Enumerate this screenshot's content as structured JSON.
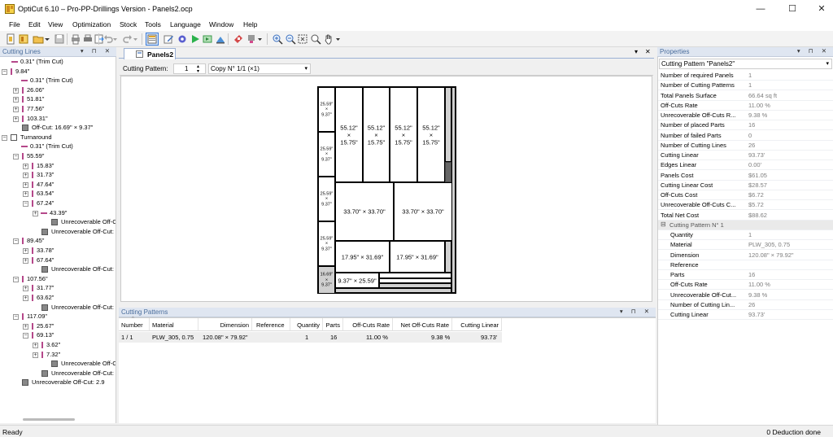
{
  "window": {
    "title": "OptiCut 6.10 – Pro-PP-Drillings Version - Panels2.ocp",
    "minimize": "—",
    "maximize": "☐",
    "close": "✕"
  },
  "menu": [
    "File",
    "Edit",
    "View",
    "Optimization",
    "Stock",
    "Tools",
    "Language",
    "Window",
    "Help"
  ],
  "toolbar_icons": [
    "new-icon",
    "new-project-icon",
    "open-icon",
    "dropdown-arrow",
    "save-icon",
    "print-preview-icon",
    "print-icon",
    "export-icon",
    "undo-icon",
    "undo-dropdown",
    "redo-icon",
    "redo-dropdown",
    "properties-icon",
    "edit-icon",
    "optimize-settings-icon",
    "run-icon",
    "step-icon",
    "report-icon",
    "label-icon",
    "drill-icon",
    "zoom-in-icon",
    "zoom-out-icon",
    "zoom-fit-icon",
    "zoom-window-icon",
    "pan-hand-icon",
    "overflow-icon"
  ],
  "cutting_lines": {
    "title": "Cutting Lines",
    "items": [
      {
        "label": "0.31\" (Trim Cut)",
        "type": "line",
        "level": 1
      },
      {
        "label": "9.84\"",
        "type": "bar",
        "level": 0,
        "expander": "-"
      },
      {
        "label": "0.31\" (Trim Cut)",
        "type": "line",
        "level": 2
      },
      {
        "label": "26.06\"",
        "type": "bar",
        "level": 2,
        "expander": "+"
      },
      {
        "label": "51.81\"",
        "type": "bar",
        "level": 2,
        "expander": "+"
      },
      {
        "label": "77.56\"",
        "type": "bar",
        "level": 2,
        "expander": "+"
      },
      {
        "label": "103.31\"",
        "type": "bar",
        "level": 2,
        "expander": "+"
      },
      {
        "label": "Off-Cut: 16.69\" × 9.37\"",
        "type": "box",
        "level": 2
      },
      {
        "label": "Turnaround",
        "type": "whitebox",
        "level": 0,
        "expander": "-"
      },
      {
        "label": "0.31\" (Trim Cut)",
        "type": "line",
        "level": 2
      },
      {
        "label": "55.59\"",
        "type": "bar",
        "level": 2,
        "expander": "-"
      },
      {
        "label": "15.83\"",
        "type": "bar",
        "level": 3,
        "expander": "+"
      },
      {
        "label": "31.73\"",
        "type": "bar",
        "level": 3,
        "expander": "+"
      },
      {
        "label": "47.64\"",
        "type": "bar",
        "level": 3,
        "expander": "+"
      },
      {
        "label": "63.54\"",
        "type": "bar",
        "level": 3,
        "expander": "+"
      },
      {
        "label": "67.24\"",
        "type": "bar",
        "level": 3,
        "expander": "-"
      },
      {
        "label": "43.39\"",
        "type": "line",
        "level": 4,
        "expander": "+"
      },
      {
        "label": "Unrecoverable Off-C",
        "type": "box",
        "level": 5
      },
      {
        "label": "Unrecoverable Off-Cut:",
        "type": "box",
        "level": 4
      },
      {
        "label": "89.45\"",
        "type": "bar",
        "level": 2,
        "expander": "-"
      },
      {
        "label": "33.78\"",
        "type": "bar",
        "level": 3,
        "expander": "+"
      },
      {
        "label": "67.64\"",
        "type": "bar",
        "level": 3,
        "expander": "+"
      },
      {
        "label": "Unrecoverable Off-Cut:",
        "type": "box",
        "level": 4
      },
      {
        "label": "107.56\"",
        "type": "bar",
        "level": 2,
        "expander": "-"
      },
      {
        "label": "31.77\"",
        "type": "bar",
        "level": 3,
        "expander": "+"
      },
      {
        "label": "63.62\"",
        "type": "bar",
        "level": 3,
        "expander": "+"
      },
      {
        "label": "Unrecoverable Off-Cut:",
        "type": "box",
        "level": 4
      },
      {
        "label": "117.09\"",
        "type": "bar",
        "level": 2,
        "expander": "-"
      },
      {
        "label": "25.67\"",
        "type": "bar",
        "level": 3,
        "expander": "+"
      },
      {
        "label": "69.13\"",
        "type": "bar",
        "level": 3,
        "expander": "-"
      },
      {
        "label": "3.62\"",
        "type": "bar",
        "level": 4,
        "expander": "+"
      },
      {
        "label": "7.32\"",
        "type": "bar",
        "level": 4,
        "expander": "+"
      },
      {
        "label": "Unrecoverable Off-C",
        "type": "box",
        "level": 5
      },
      {
        "label": "Unrecoverable Off-Cut:",
        "type": "box",
        "level": 4
      },
      {
        "label": "Unrecoverable Off-Cut: 2.9",
        "type": "box",
        "level": 2
      }
    ]
  },
  "document": {
    "tab": "Panels2",
    "pattern_label": "Cutting Pattern:",
    "pattern_value": "1",
    "copy_value": "Copy N° 1/1 (×1)"
  },
  "layout_pieces": {
    "strip_label_a": "25.59\"",
    "strip_label_b": "×",
    "strip_label_c": "9.37\"",
    "offcut_a": "16.69\"",
    "offcut_c": "9.37\"",
    "p55_a": "55.12\"",
    "p55_b": "×",
    "p55_c": "15.75\"",
    "p33": "33.70\" × 33.70\"",
    "p17": "17.95\" × 31.69\"",
    "p9": "9.37\" × 25.59\""
  },
  "cutting_patterns": {
    "title": "Cutting Patterns",
    "columns": [
      "Number",
      "Material",
      "Dimension",
      "Reference",
      "Quantity",
      "Parts",
      "Off-Cuts Rate",
      "Net Off-Cuts Rate",
      "Cutting Linear"
    ],
    "rows": [
      {
        "number": "1 / 1",
        "material": "PLW_305, 0.75",
        "dimension": "120.08\" × 79.92\"",
        "reference": "",
        "quantity": "1",
        "parts": "16",
        "offcuts_rate": "11.00 %",
        "net_offcuts_rate": "9.38 %",
        "cutting_linear": "93.73'"
      }
    ]
  },
  "properties": {
    "title": "Properties",
    "selector": "Cutting Pattern \"Panels2\"",
    "rows": [
      {
        "k": "Number of required Panels",
        "v": "1"
      },
      {
        "k": "Number of Cutting Patterns",
        "v": "1"
      },
      {
        "k": "Total Panels Surface",
        "v": "66.64 sq ft"
      },
      {
        "k": "Off-Cuts Rate",
        "v": "11.00 %"
      },
      {
        "k": "Unrecoverable Off-Cuts R...",
        "v": "9.38 %"
      },
      {
        "k": "Number of placed Parts",
        "v": "16"
      },
      {
        "k": "Number of failed Parts",
        "v": "0"
      },
      {
        "k": "Number of Cutting Lines",
        "v": "26"
      },
      {
        "k": "Cutting Linear",
        "v": "93.73'"
      },
      {
        "k": "Edges Linear",
        "v": "0.00'"
      },
      {
        "k": "Panels Cost",
        "v": "$61.05"
      },
      {
        "k": "Cutting Linear Cost",
        "v": "$28.57"
      },
      {
        "k": "Off-Cuts Cost",
        "v": "$6.72"
      },
      {
        "k": "Unrecoverable Off-Cuts C...",
        "v": "$5.72"
      },
      {
        "k": "Total Net Cost",
        "v": "$88.62"
      }
    ],
    "group": "Cutting Pattern N° 1",
    "group_rows": [
      {
        "k": "Quantity",
        "v": "1"
      },
      {
        "k": "Material",
        "v": "PLW_305, 0.75"
      },
      {
        "k": "Dimension",
        "v": "120.08\" × 79.92\""
      },
      {
        "k": "Reference",
        "v": ""
      },
      {
        "k": "Parts",
        "v": "16"
      },
      {
        "k": "Off-Cuts Rate",
        "v": "11.00 %"
      },
      {
        "k": "Unrecoverable Off-Cut...",
        "v": "9.38 %"
      },
      {
        "k": "Number of Cutting Lin...",
        "v": "26"
      },
      {
        "k": "Cutting Linear",
        "v": "93.73'"
      }
    ]
  },
  "status": {
    "left": "Ready",
    "right": "0 Deduction done"
  }
}
